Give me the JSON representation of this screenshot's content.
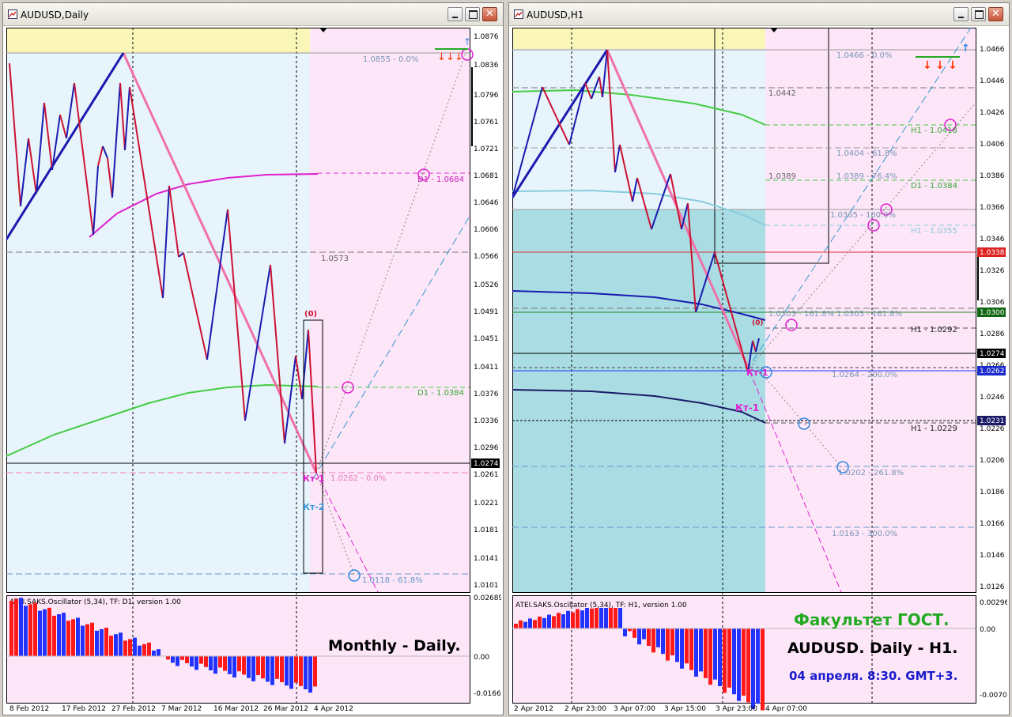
{
  "left_window": {
    "title": "AUDUSD,Daily",
    "price_ticks": [
      "1.0876",
      "1.0836",
      "1.0796",
      "1.0761",
      "1.0721",
      "1.0681",
      "1.0646",
      "1.0606",
      "1.0566",
      "1.0526",
      "1.0491",
      "1.0451",
      "1.0411",
      "1.0376",
      "1.0336",
      "1.0296",
      "1.0261",
      "1.0221",
      "1.0181",
      "1.0141",
      "1.0101"
    ],
    "current_price": "1.0274",
    "time_ticks": [
      "8 Feb 2012",
      "17 Feb 2012",
      "27 Feb 2012",
      "7 Mar 2012",
      "16 Mar 2012",
      "26 Mar 2012",
      "4 Apr 2012"
    ],
    "levels": {
      "l0855": "1.0855 - 0.0%",
      "l0684": "D1 - 1.0684",
      "l0573": "1.0573",
      "l0384": "D1 - 1.0384",
      "l0262": "1.0262 - 0.0%",
      "l0118": "1.0118 - 61.8%"
    },
    "tags": {
      "zero": "(0)",
      "kt1": "Кт-1",
      "kt2": "Кт-2"
    },
    "oscillator": {
      "title": "ATEI.SAKS.Oscillator (5,34), TF: D1, version 1.00",
      "ticks": [
        "0.02689",
        "0.00",
        "-0.01669"
      ]
    },
    "caption": "Monthly - Daily."
  },
  "right_window": {
    "title": "AUDUSD,H1",
    "price_ticks": [
      "1.0466",
      "1.0446",
      "1.0426",
      "1.0406",
      "1.0386",
      "1.0366",
      "1.0346",
      "1.0326",
      "1.0306",
      "1.0286",
      "1.0266",
      "1.0246",
      "1.0226",
      "1.0206",
      "1.0186",
      "1.0166",
      "1.0146",
      "1.0126"
    ],
    "price_boxes": {
      "b0338": "1.0338",
      "b0300": "1.0300",
      "b0274": "1.0274",
      "b0262": "1.0262",
      "b0231": "1.0231"
    },
    "time_ticks": [
      "2 Apr 2012",
      "2 Apr 23:00",
      "3 Apr 07:00",
      "3 Apr 15:00",
      "3 Apr 23:00",
      "4 Apr 07:00"
    ],
    "levels": {
      "l0466": "1.0466 - 0.0%",
      "l0442": "1.0442",
      "l0418": "H1 - 1.0418",
      "l0404": "1.0404 - 61.8%",
      "l0389a": "1.0389",
      "l0389b": "1.0389 - 76.4%",
      "l0384": "D1 - 1.0384",
      "l0365": "1.0365 - 100.0%",
      "l0355": "H1 - 1.0355",
      "l0303a": "1.0303 - 161.8%",
      "l0303b": "1.0303 - 161.8%",
      "l0292": "H1 - 1.0292",
      "l0264": "1.0264 - 200.0%",
      "l0229": "H1 - 1.0229",
      "l0202": "1.0202 - 261.8%",
      "l0163": "1.0163 - 300.0%"
    },
    "tags": {
      "zero": "(0)",
      "kt1a": "Кт-1",
      "kt1b": "Кт-1"
    },
    "oscillator": {
      "title": "ATEI.SAKS.Oscillator (5,34), TF: H1, version 1.00",
      "ticks": [
        "0.00296",
        "0.00",
        "-0.00703"
      ]
    },
    "caption1": "Факультет ГОСТ.",
    "caption2": "AUDUSD. Daily - H1.",
    "caption3": "04 апреля. 8:30. GMT+3."
  },
  "colors": {
    "bear": "#cc1133",
    "bull": "#1a1ab0",
    "pink_line": "#f070a8",
    "magenta": "#e020d0",
    "green_ma": "#44cc44",
    "osc_red": "#ff1a1a",
    "osc_blue": "#2233ff",
    "caption_green": "#22aa22",
    "caption_blue": "#1a1acc"
  }
}
